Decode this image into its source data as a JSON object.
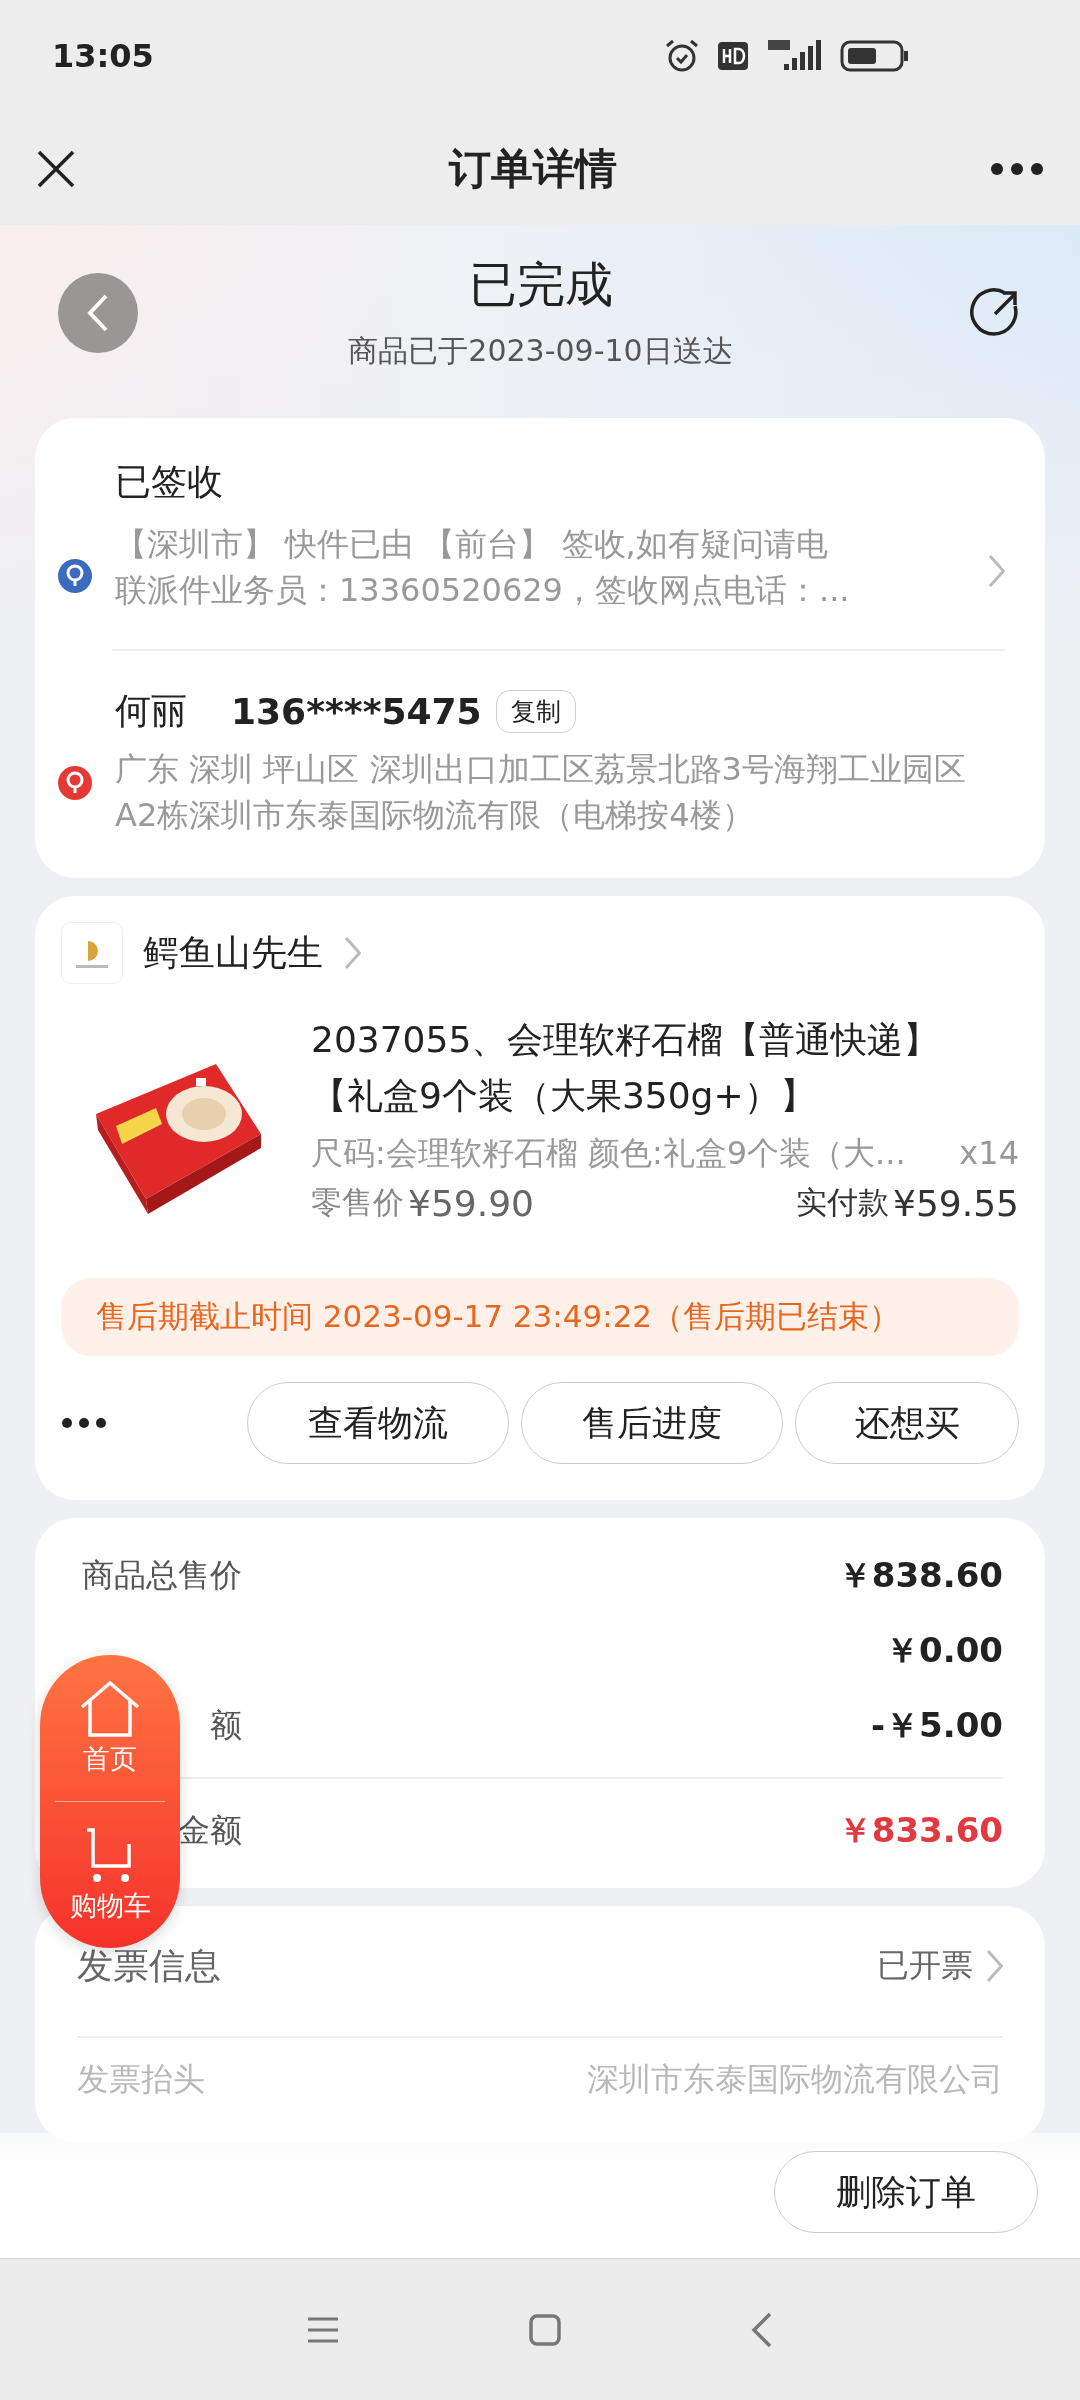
{
  "status_bar": {
    "time": "13:05"
  },
  "nav": {
    "title": "订单详情"
  },
  "header": {
    "status": "已完成",
    "subtitle": "商品已于2023-09-10日送达"
  },
  "logistics": {
    "title": "已签收",
    "lines": [
      "【深圳市】 快件已由 【前台】 签收,如有疑问请电",
      "联派件业务员：13360520629，签收网点电话：..."
    ]
  },
  "recipient": {
    "name": "何丽",
    "phone": "136****5475",
    "copy": "复制",
    "address": "广东 深圳 坪山区 深圳出口加工区荔景北路3号海翔工业园区A2栋深圳市东泰国际物流有限（电梯按4楼）"
  },
  "store": {
    "name": "鳄鱼山先生"
  },
  "product": {
    "title": "2037055、会理软籽石榴【普通快递】【礼盒9个装（大果350g+）】",
    "spec": "尺码:会理软籽石榴 颜色:礼盒9个装（大...",
    "qty": "x14",
    "retail_label": "零售价",
    "retail_price": "¥59.90",
    "paid_label": "实付款",
    "paid_price": "¥59.55"
  },
  "after_sale": "售后期截止时间 2023-09-17 23:49:22（售后期已结束）",
  "actions": [
    "查看物流",
    "售后进度",
    "还想买"
  ],
  "summary": [
    {
      "label": "商品总售价",
      "value": "￥838.60",
      "kind": "normal"
    },
    {
      "value": "￥0.00",
      "kind": "normal"
    },
    {
      "label": "额",
      "value": "-￥5.00",
      "kind": "normal"
    },
    {
      "label": "金额",
      "value": "￥833.60",
      "kind": "total"
    }
  ],
  "float_nav": [
    {
      "label": "首页",
      "kind": "home"
    },
    {
      "label": "购物车",
      "kind": "cart"
    }
  ],
  "invoice": {
    "title": "发票信息",
    "status": "已开票",
    "header_label": "发票抬头",
    "header_value": "深圳市东泰国际物流有限公司"
  },
  "delete_button": "删除订单"
}
